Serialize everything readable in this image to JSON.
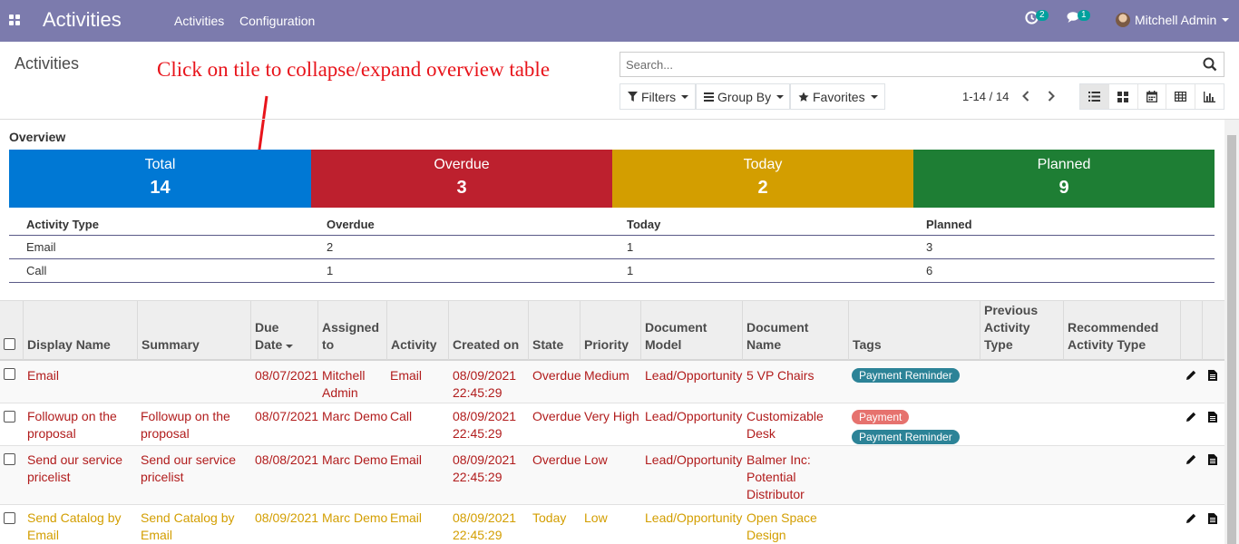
{
  "navbar": {
    "brand": "Activities",
    "menu": [
      "Activities",
      "Configuration"
    ],
    "activity_badge": "2",
    "message_badge": "1",
    "user_name": "Mitchell Admin"
  },
  "control_panel": {
    "breadcrumb": "Activities",
    "search_placeholder": "Search...",
    "filters_label": "Filters",
    "groupby_label": "Group By",
    "favorites_label": "Favorites",
    "pager": "1-14 / 14"
  },
  "annotation": "Click on tile to collapse/expand overview table",
  "overview": {
    "title": "Overview",
    "tiles": [
      {
        "label": "Total",
        "value": "14",
        "color": "#0078d4"
      },
      {
        "label": "Overdue",
        "value": "3",
        "color": "#bd202e"
      },
      {
        "label": "Today",
        "value": "2",
        "color": "#d39e00"
      },
      {
        "label": "Planned",
        "value": "9",
        "color": "#1e7e34"
      }
    ],
    "headers": [
      "Activity Type",
      "Overdue",
      "Today",
      "Planned"
    ],
    "rows": [
      [
        "Email",
        "2",
        "1",
        "3"
      ],
      [
        "Call",
        "1",
        "1",
        "6"
      ]
    ]
  },
  "list": {
    "headers": [
      "Display Name",
      "Summary",
      "Due Date",
      "Assigned to",
      "Activity",
      "Created on",
      "State",
      "Priority",
      "Document Model",
      "Document Name",
      "Tags",
      "Previous Activity Type",
      "Recommended Activity Type"
    ],
    "rows": [
      {
        "display_name": "Email",
        "summary": "",
        "due_date": "08/07/2021",
        "assigned_to": "Mitchell Admin",
        "activity": "Email",
        "created_on": "08/09/2021 22:45:29",
        "state": "Overdue",
        "priority": "Medium",
        "doc_model": "Lead/Opportunity",
        "doc_name": "5 VP Chairs",
        "tags": [
          "Payment Reminder"
        ]
      },
      {
        "display_name": "Followup on the proposal",
        "summary": "Followup on the proposal",
        "due_date": "08/07/2021",
        "assigned_to": "Marc Demo",
        "activity": "Call",
        "created_on": "08/09/2021 22:45:29",
        "state": "Overdue",
        "priority": "Very High",
        "doc_model": "Lead/Opportunity",
        "doc_name": "Customizable Desk",
        "tags": [
          "Payment",
          "Payment Reminder"
        ]
      },
      {
        "display_name": "Send our service pricelist",
        "summary": "Send our service pricelist",
        "due_date": "08/08/2021",
        "assigned_to": "Marc Demo",
        "activity": "Email",
        "created_on": "08/09/2021 22:45:29",
        "state": "Overdue",
        "priority": "Low",
        "doc_model": "Lead/Opportunity",
        "doc_name": "Balmer Inc: Potential Distributor",
        "tags": []
      },
      {
        "display_name": "Send Catalog by Email",
        "summary": "Send Catalog by Email",
        "due_date": "08/09/2021",
        "assigned_to": "Marc Demo",
        "activity": "Email",
        "created_on": "08/09/2021 22:45:29",
        "state": "Today",
        "priority": "Low",
        "doc_model": "Lead/Opportunity",
        "doc_name": "Open Space Design",
        "tags": []
      }
    ]
  },
  "colors": {
    "navbar": "#7c7bad",
    "overdue_text": "#b11c1c",
    "today_text": "#d39e00",
    "tag_payment_reminder": "#2c8397",
    "tag_payment": "#e6726e"
  }
}
